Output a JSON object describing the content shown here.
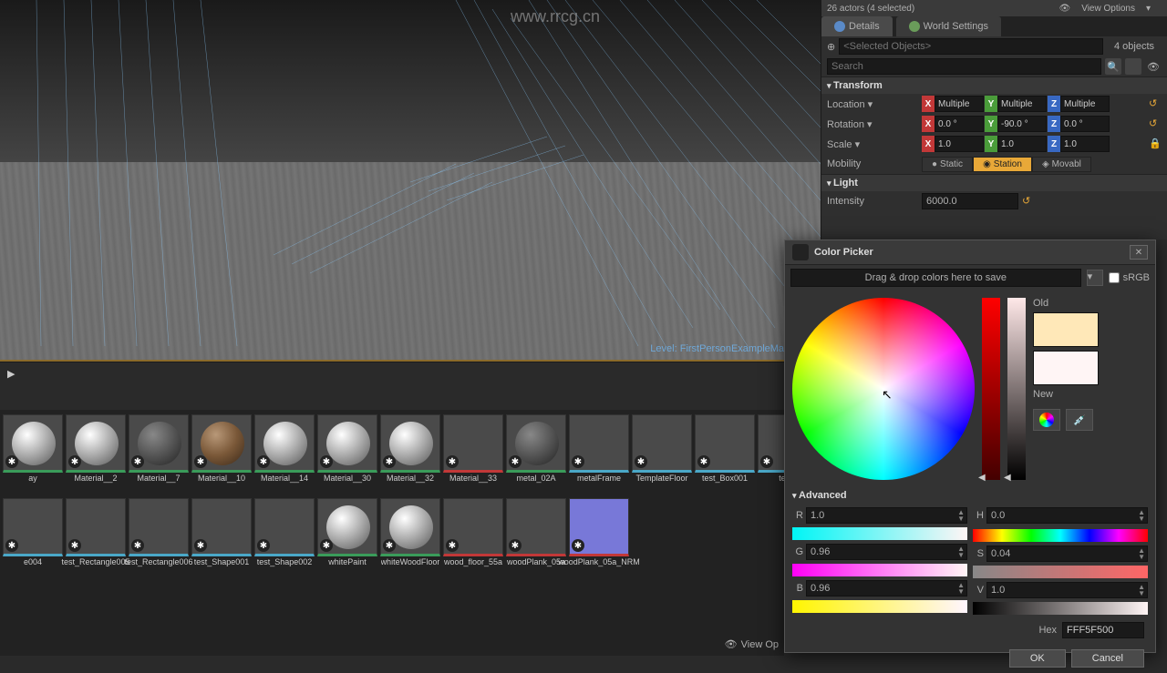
{
  "watermark_url": "www.rrcg.cn",
  "viewport": {
    "level_label": "Level:",
    "level_name": "FirstPersonExampleMap (Per"
  },
  "sidebar": {
    "actors_count": "26 actors (4 selected)",
    "view_options": "View Options",
    "tabs": {
      "details": "Details",
      "world_settings": "World Settings"
    },
    "selected_placeholder": "<Selected Objects>",
    "objects_count": "4 objects",
    "search_placeholder": "Search",
    "transform": {
      "title": "Transform",
      "location": {
        "label": "Location",
        "x": "Multiple",
        "y": "Multiple",
        "z": "Multiple"
      },
      "rotation": {
        "label": "Rotation",
        "x": "0.0 °",
        "y": "-90.0 °",
        "z": "0.0 °"
      },
      "scale": {
        "label": "Scale",
        "x": "1.0",
        "y": "1.0",
        "z": "1.0"
      },
      "mobility": {
        "label": "Mobility",
        "static": "Static",
        "stationary": "Station",
        "movable": "Movabl"
      }
    },
    "light": {
      "title": "Light",
      "intensity_label": "Intensity",
      "intensity_value": "6000.0"
    }
  },
  "color_picker": {
    "title": "Color Picker",
    "drag_drop": "Drag & drop colors here to save",
    "srgb": "sRGB",
    "old_label": "Old",
    "new_label": "New",
    "advanced": "Advanced",
    "r": "1.0",
    "g": "0.96",
    "b": "0.96",
    "h": "0.0",
    "s": "0.04",
    "v": "1.0",
    "r_label": "R",
    "g_label": "G",
    "b_label": "B",
    "h_label": "H",
    "s_label": "S",
    "v_label": "V",
    "hex_label": "Hex",
    "hex_value": "FFF5F500",
    "ok": "OK",
    "cancel": "Cancel"
  },
  "assets_row1": [
    {
      "name": "ay",
      "type": "mat"
    },
    {
      "name": "Material__2",
      "type": "mat"
    },
    {
      "name": "Material__7",
      "type": "mat-dark"
    },
    {
      "name": "Material__10",
      "type": "mat-brown"
    },
    {
      "name": "Material__14",
      "type": "mat"
    },
    {
      "name": "Material__30",
      "type": "mat"
    },
    {
      "name": "Material__32",
      "type": "mat"
    },
    {
      "name": "Material__33",
      "type": "tex"
    },
    {
      "name": "metal_02A",
      "type": "mat-dark"
    },
    {
      "name": "metalFrame",
      "type": "mesh"
    },
    {
      "name": "TemplateFloor",
      "type": "mesh"
    },
    {
      "name": "test_Box001",
      "type": "mesh"
    },
    {
      "name": "test_",
      "type": "mesh"
    }
  ],
  "assets_row2": [
    {
      "name": "e004",
      "type": "mesh"
    },
    {
      "name": "test_Rectangle005",
      "type": "mesh"
    },
    {
      "name": "test_Rectangle006",
      "type": "mesh"
    },
    {
      "name": "test_Shape001",
      "type": "mesh"
    },
    {
      "name": "test_Shape002",
      "type": "mesh"
    },
    {
      "name": "whitePaint",
      "type": "mat"
    },
    {
      "name": "whiteWoodFloor",
      "type": "mat"
    },
    {
      "name": "wood_floor_55a",
      "type": "tex"
    },
    {
      "name": "woodPlank_05a",
      "type": "tex"
    },
    {
      "name": "woodPlank_05a_NRM",
      "type": "norm"
    }
  ],
  "view_options_label": "View Op"
}
